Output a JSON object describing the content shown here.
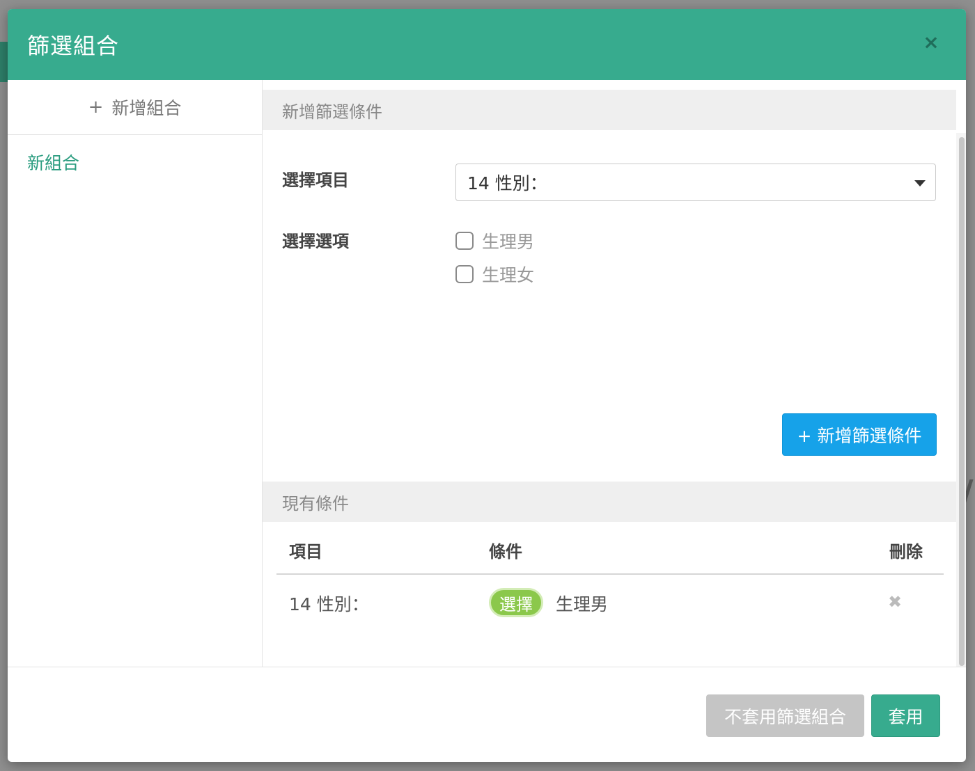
{
  "modal": {
    "title": "篩選組合",
    "close_icon": "×"
  },
  "sidebar": {
    "add_icon": "+",
    "add_label": "新增組合",
    "items": [
      {
        "label": "新組合"
      }
    ]
  },
  "add_condition_section": {
    "header": "新增篩選條件",
    "select_item_label": "選擇項目",
    "selected_item": "14 性別：",
    "select_option_label": "選擇選項",
    "options": [
      {
        "label": "生理男",
        "checked": false
      },
      {
        "label": "生理女",
        "checked": false
      }
    ],
    "add_button_label": "+ 新增篩選條件"
  },
  "existing_section": {
    "header": "現有條件",
    "columns": [
      "項目",
      "條件",
      "刪除"
    ],
    "rows": [
      {
        "item": "14 性別：",
        "tag": "選擇",
        "value": "生理男",
        "delete_icon": "✖"
      }
    ]
  },
  "footer": {
    "cancel_label": "不套用篩選組合",
    "apply_label": "套用"
  },
  "colors": {
    "header": "#37ab8e",
    "primary_button": "#16a2e9",
    "tag": "#8bc84b",
    "disabled_button": "#c5c5c5"
  }
}
